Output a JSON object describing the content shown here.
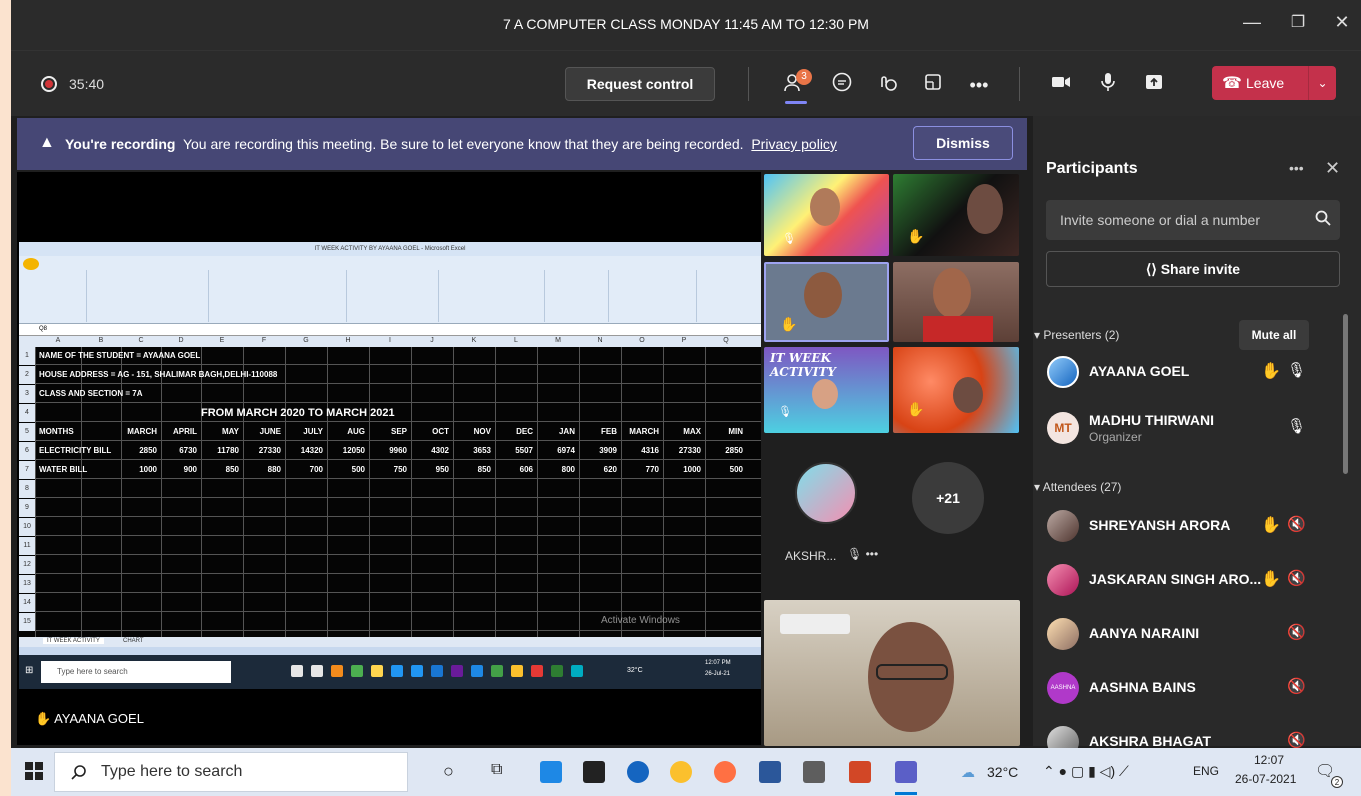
{
  "window": {
    "title": "7 A COMPUTER CLASS MONDAY 11:45 AM TO 12:30 PM"
  },
  "meeting": {
    "timer": "35:40",
    "request_control": "Request control",
    "leave_label": "Leave",
    "participant_badge": "3"
  },
  "banner": {
    "heading": "You're recording",
    "message": "You are recording this meeting. Be sure to let everyone know that they are being recorded.",
    "link": "Privacy policy",
    "dismiss": "Dismiss"
  },
  "shared_screen": {
    "excel_title": "IT WEEK ACTIVITY BY AYAANA GOEL - Microsoft Excel",
    "cell_ref": "Q8",
    "columns": [
      "A",
      "B",
      "C",
      "D",
      "E",
      "F",
      "G",
      "H",
      "I",
      "J",
      "K",
      "L",
      "M",
      "N",
      "O",
      "P",
      "Q"
    ],
    "rows": [
      {
        "n": "1",
        "label": "NAME OF THE STUDENT  = AYAANA GOEL",
        "vals": []
      },
      {
        "n": "2",
        "label": "HOUSE ADDRESS = AG - 151, SHALIMAR BAGH,DELHI-110088",
        "vals": []
      },
      {
        "n": "3",
        "label": "CLASS AND SECTION = 7A",
        "vals": []
      },
      {
        "n": "4",
        "label": "",
        "vals": []
      },
      {
        "n": "5",
        "label": "MONTHS",
        "vals": [
          "MARCH",
          "APRIL",
          "MAY",
          "JUNE",
          "JULY",
          "AUG",
          "SEP",
          "OCT",
          "NOV",
          "DEC",
          "JAN",
          "FEB",
          "MARCH",
          "MAX",
          "MIN"
        ]
      },
      {
        "n": "6",
        "label": "ELECTRICITY BILL",
        "vals": [
          "2850",
          "6730",
          "11780",
          "27330",
          "14320",
          "12050",
          "9960",
          "4302",
          "3653",
          "5507",
          "6974",
          "3909",
          "4316",
          "27330",
          "2850"
        ]
      },
      {
        "n": "7",
        "label": "WATER BILL",
        "vals": [
          "1000",
          "900",
          "850",
          "880",
          "700",
          "500",
          "750",
          "950",
          "850",
          "606",
          "800",
          "620",
          "770",
          "1000",
          "500"
        ]
      },
      {
        "n": "8",
        "label": "",
        "vals": []
      },
      {
        "n": "9",
        "label": "",
        "vals": []
      },
      {
        "n": "10",
        "label": "",
        "vals": []
      },
      {
        "n": "11",
        "label": "",
        "vals": []
      },
      {
        "n": "12",
        "label": "",
        "vals": []
      },
      {
        "n": "13",
        "label": "",
        "vals": []
      },
      {
        "n": "14",
        "label": "",
        "vals": []
      },
      {
        "n": "15",
        "label": "",
        "vals": []
      }
    ],
    "heading_row4": "FROM MARCH 2020 TO MARCH 2021",
    "sheet_tabs": [
      "IT WEEK ACTIVITY",
      "CHART"
    ],
    "taskbar_search": "Type here to search",
    "inner_clock": "12:07 PM",
    "inner_date": "26-Jul-21",
    "inner_temp": "32°C",
    "activate": "Activate Windows",
    "presenter": "AYAANA GOEL"
  },
  "tiles": {
    "it_week": "IT WEEK ACTIVITY",
    "aksh_name": "AKSHR...",
    "more": "+21"
  },
  "panel": {
    "title": "Participants",
    "invite_placeholder": "Invite someone or dial a number",
    "share_invite": "Share invite",
    "presenters_header": "Presenters (2)",
    "mute_all": "Mute all",
    "attendees_header": "Attendees (27)",
    "presenters": [
      {
        "name": "AYAANA GOEL",
        "role": "",
        "hand": true,
        "mic": "on"
      },
      {
        "name": "MADHU THIRWANI",
        "role": "Organizer",
        "initials": "MT",
        "hand": false,
        "mic": "on"
      }
    ],
    "attendees": [
      {
        "name": "SHREYANSH ARORA",
        "hand": true
      },
      {
        "name": "JASKARAN SINGH ARO...",
        "hand": true
      },
      {
        "name": "AANYA NARAINI",
        "hand": false
      },
      {
        "name": "AASHNA BAINS",
        "hand": false,
        "avatar_text": "AASHNA"
      },
      {
        "name": "AKSHRA BHAGAT",
        "hand": false
      }
    ]
  },
  "taskbar": {
    "search": "Type here to search",
    "temp": "32°C",
    "lang": "ENG",
    "time": "12:07",
    "date": "26-07-2021",
    "notif": "2"
  }
}
